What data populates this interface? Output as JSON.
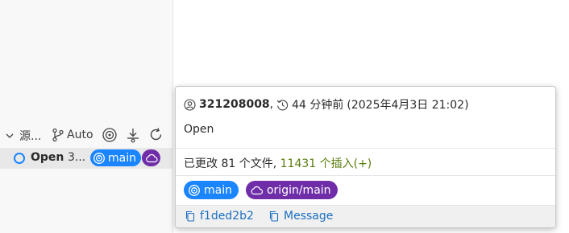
{
  "graph": {
    "header": {
      "title": "源...",
      "branch_label": "Auto"
    },
    "row": {
      "message": "Open",
      "author": "3...",
      "branch": "main"
    }
  },
  "hover": {
    "author": "321208008",
    "relative_time": "44 分钟前",
    "absolute_time": "(2025年4月3日 21:02)",
    "message": "Open",
    "stats": {
      "changed": "已更改 81 个文件,",
      "insertions": "11431 个插入(+)"
    },
    "refs": {
      "local": "main",
      "remote": "origin/main"
    },
    "footer": {
      "hash": "f1ded2b2",
      "message_action": "Message"
    }
  },
  "colors": {
    "local_branch": "#1a85ff",
    "remote_branch": "#6f2ea8",
    "insertions": "#587c0c",
    "link": "#1a6fc4"
  },
  "icons": {
    "collapse": "chevron-down-icon",
    "branch": "git-branch-icon",
    "target": "target-icon",
    "fetch": "fetch-icon",
    "refresh": "refresh-icon",
    "cloud": "cloud-icon",
    "person": "person-icon",
    "history": "history-icon",
    "copy": "copy-icon"
  }
}
